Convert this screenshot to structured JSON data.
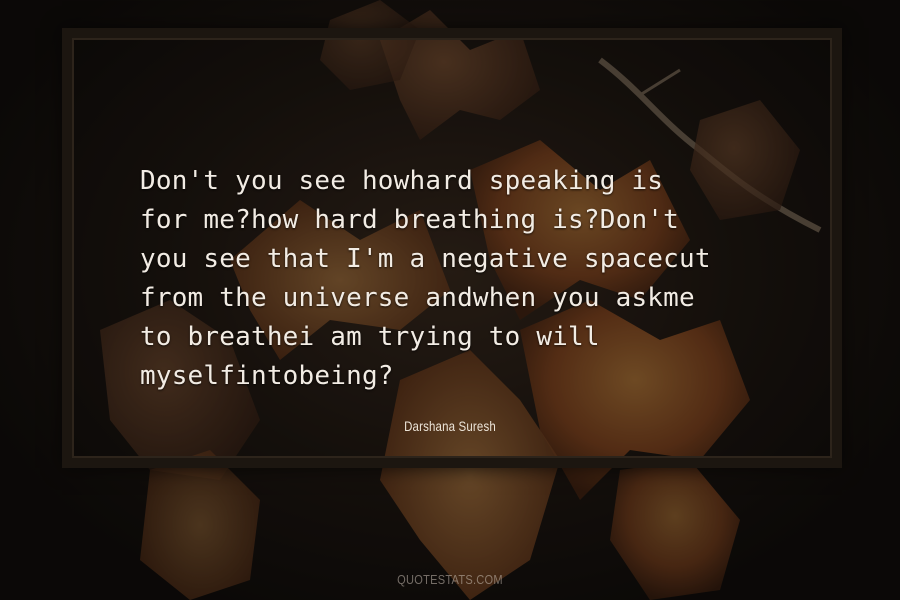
{
  "quote": {
    "lines": [
      "Don't you see howhard speaking is",
      "for me?how hard breathing is?Don't",
      "you see that I'm a negative spacecut",
      "from the universe andwhen you askme",
      "to breathei am trying to will",
      "myselfintobeing?"
    ]
  },
  "author": "Darshana Suresh",
  "watermark": "QUOTESTATS.COM",
  "colors": {
    "text": "#f2ece4",
    "leaf_orange": "#b5652a",
    "leaf_dark": "#5a2e14",
    "background": "#0d0b0a"
  }
}
